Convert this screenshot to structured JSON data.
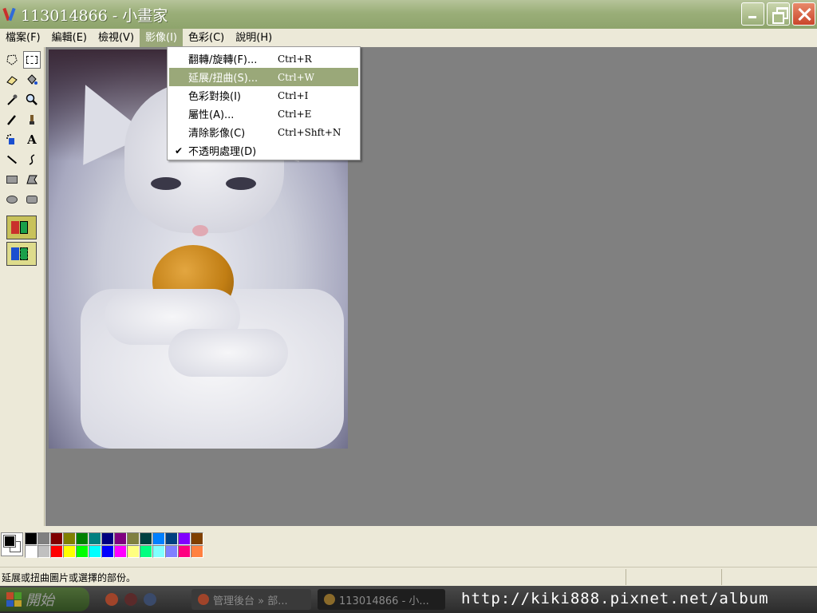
{
  "window": {
    "title": "113014866 - 小畫家"
  },
  "menubar": {
    "items": [
      {
        "label": "檔案(F)"
      },
      {
        "label": "編輯(E)"
      },
      {
        "label": "檢視(V)"
      },
      {
        "label": "影像(I)"
      },
      {
        "label": "色彩(C)"
      },
      {
        "label": "說明(H)"
      }
    ]
  },
  "image_menu": {
    "items": [
      {
        "label": "翻轉/旋轉(F)...",
        "shortcut": "Ctrl+R",
        "checked": false
      },
      {
        "label": "延展/扭曲(S)...",
        "shortcut": "Ctrl+W",
        "checked": false,
        "highlighted": true
      },
      {
        "label": "色彩對換(I)",
        "shortcut": "Ctrl+I",
        "checked": false
      },
      {
        "label": "屬性(A)...",
        "shortcut": "Ctrl+E",
        "checked": false
      },
      {
        "label": "清除影像(C)",
        "shortcut": "Ctrl+Shft+N",
        "checked": false
      },
      {
        "label": "不透明處理(D)",
        "shortcut": "",
        "checked": true
      }
    ],
    "check_glyph": "✔"
  },
  "toolbox": {
    "text_tool_glyph": "A"
  },
  "palette": {
    "foreground": "#000000",
    "background": "#ffffff",
    "colors": [
      "#000000",
      "#808080",
      "#800000",
      "#808000",
      "#008000",
      "#008080",
      "#000080",
      "#800080",
      "#808040",
      "#004040",
      "#0080ff",
      "#004080",
      "#8000ff",
      "#804000",
      "#ffffff",
      "#c0c0c0",
      "#ff0000",
      "#ffff00",
      "#00ff00",
      "#00ffff",
      "#0000ff",
      "#ff00ff",
      "#ffff80",
      "#00ff80",
      "#80ffff",
      "#8080ff",
      "#ff0080",
      "#ff8040"
    ]
  },
  "statusbar": {
    "text": "延展或扭曲圖片或選擇的部份。"
  },
  "taskbar": {
    "start_label": "開始",
    "tasks": [
      {
        "label": "管理後台 » 部..."
      },
      {
        "label": "113014866 - 小..."
      }
    ],
    "watermark": "http://kiki888.pixnet.net/album"
  },
  "colors": {
    "titlebar": "#9aae78",
    "menu_highlight": "#9aa879",
    "workspace": "#808080"
  }
}
